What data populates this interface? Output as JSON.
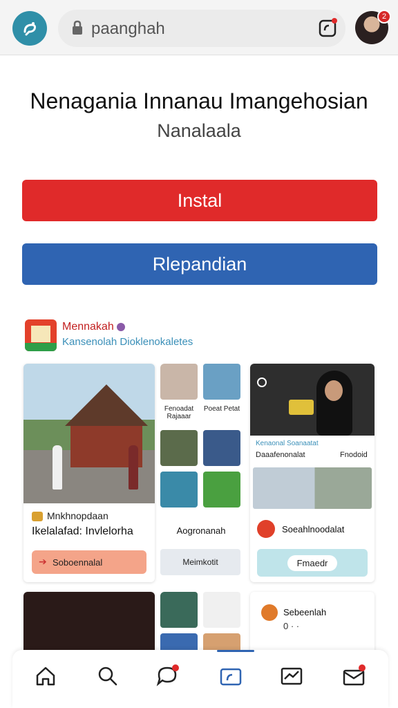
{
  "browser": {
    "url": "paanghah",
    "tabs_icon": "tabs-icon",
    "avatar_badge": "2"
  },
  "header": {
    "title": "Nenagania Innanau Imangehosian",
    "subtitle": "Nanalaala"
  },
  "actions": {
    "install_label": "Instal",
    "secondary_label": "Rlepandian",
    "install_color": "#e02a2a",
    "secondary_color": "#2f64b2"
  },
  "feed": {
    "name": "Mennakah",
    "tagline": "Kansenolah Dioklenokaletes",
    "cards": {
      "c1": {
        "meta1": "Mnkhnopdaan",
        "meta2": "Ikelalafad: Invlelorha",
        "button": "Soboennalal"
      },
      "c2": {
        "label1": "Fenoadat Rajaaar",
        "label2": "Poeat Petat",
        "caption": "Aogronanah",
        "button": "Meimkotit"
      },
      "c3": {
        "label1": "Kenaonal Soanaatat",
        "label2": "Daaafenonalat",
        "label3": "Fnodoid",
        "label4": "Soeahlnoodalat",
        "button": "Fmaedr"
      },
      "c6": {
        "label": "Sebeenlah",
        "dots": "0 · ·"
      }
    }
  },
  "nav": {
    "items": [
      "home-icon",
      "search-icon",
      "chat-icon",
      "camera-icon",
      "mail-icon",
      "inbox-icon"
    ]
  }
}
